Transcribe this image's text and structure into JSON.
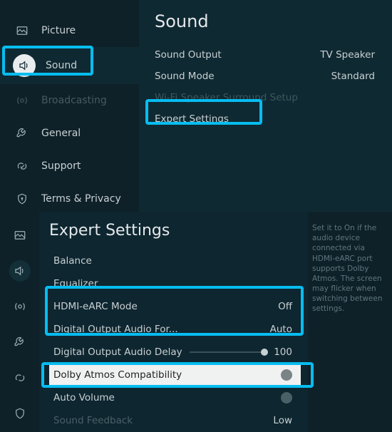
{
  "top": {
    "title": "Sound",
    "sidebar": [
      {
        "label": "Picture"
      },
      {
        "label": "Sound"
      },
      {
        "label": "Broadcasting"
      },
      {
        "label": "General"
      },
      {
        "label": "Support"
      },
      {
        "label": "Terms & Privacy"
      }
    ],
    "rows": [
      {
        "label": "Sound Output",
        "value": "TV Speaker"
      },
      {
        "label": "Sound Mode",
        "value": "Standard"
      },
      {
        "label": "Wi-Fi Speaker Surround Setup",
        "value": ""
      },
      {
        "label": "Expert Settings",
        "value": ""
      }
    ]
  },
  "bottom": {
    "title": "Expert Settings",
    "help": "Set it to On if the audio device connected via HDMI-eARC port supports Dolby Atmos. The screen may flicker when switching between settings.",
    "rows": {
      "balance": "Balance",
      "equalizer": "Equalizer",
      "hdmi": "HDMI-eARC Mode",
      "hdmi_val": "Off",
      "digfmt": "Digital Output Audio For...",
      "digfmt_val": "Auto",
      "delay": "Digital Output Audio Delay",
      "delay_val": "100",
      "dolby": "Dolby Atmos Compatibility",
      "autovol": "Auto Volume",
      "feedback": "Sound Feedback",
      "feedback_val": "Low"
    }
  }
}
